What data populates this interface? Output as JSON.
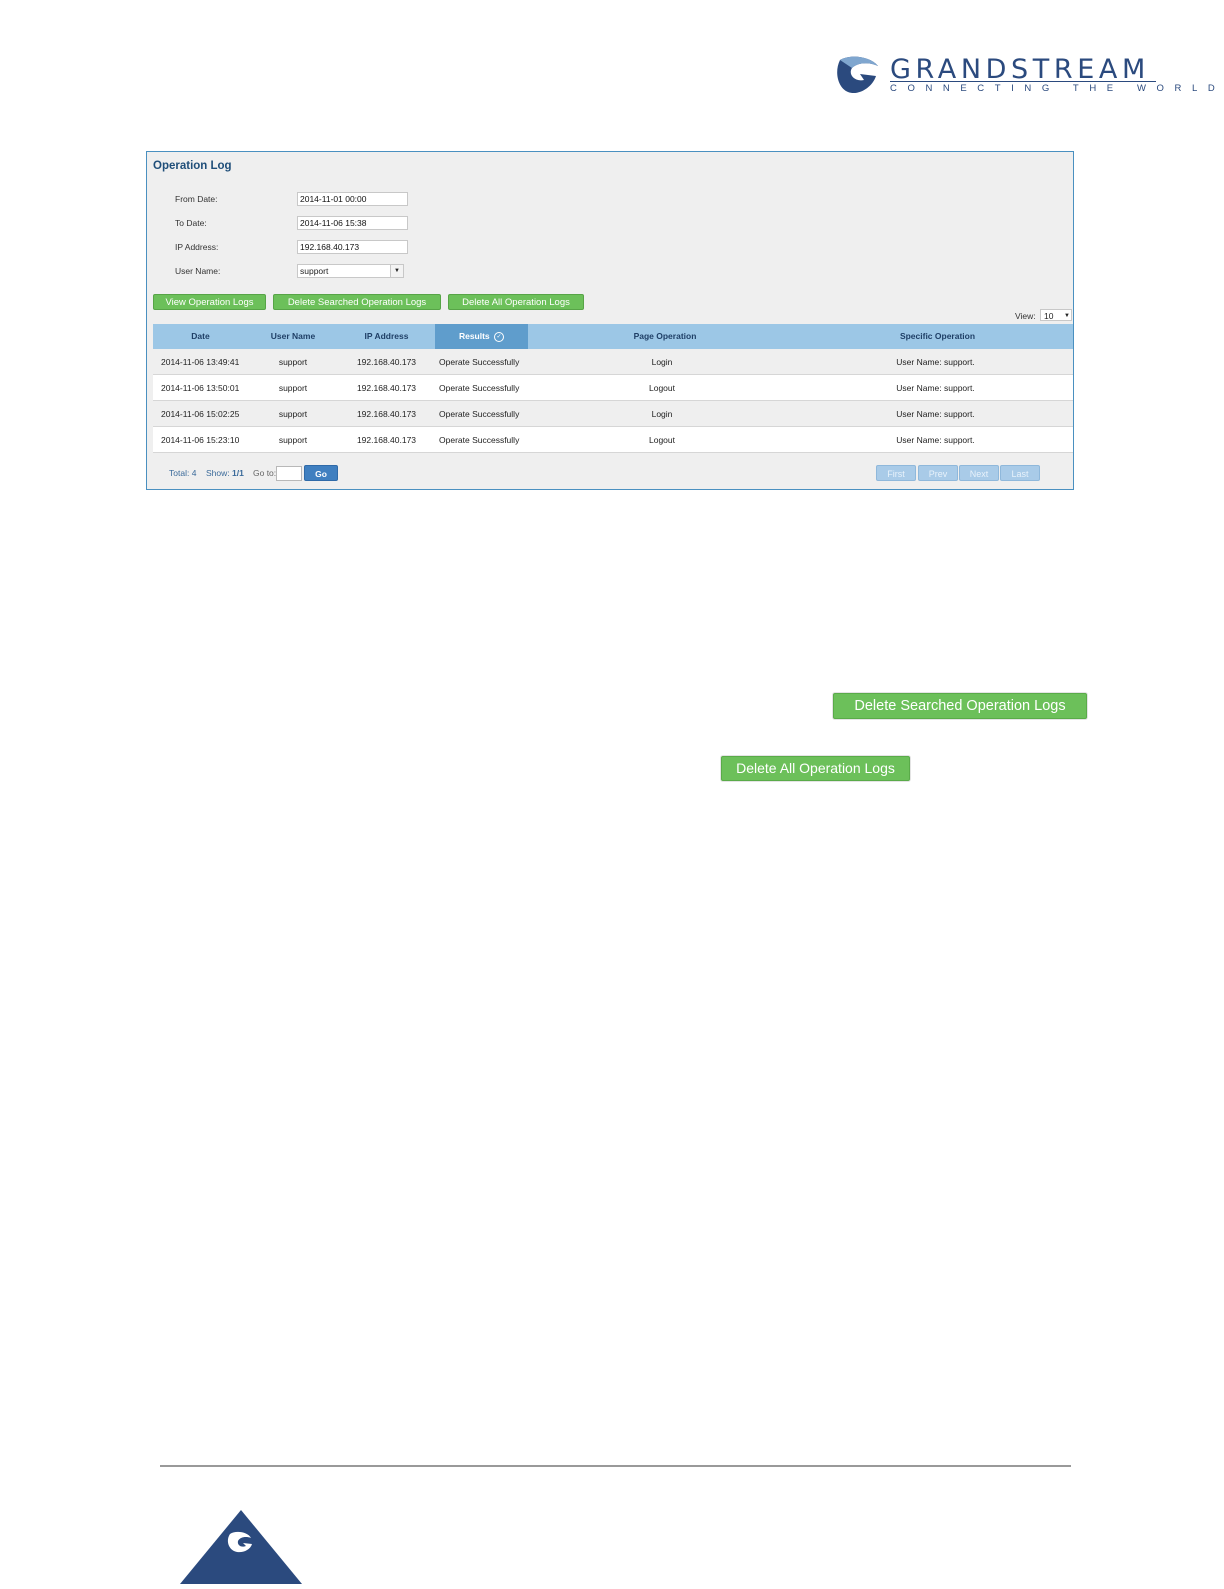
{
  "brand": {
    "name": "GRANDSTREAM",
    "tagline": "CONNECTING THE WORLD",
    "color": "#2b4a7e"
  },
  "panel": {
    "title": "Operation Log",
    "form": {
      "from_date_label": "From Date:",
      "from_date_value": "2014-11-01 00:00",
      "to_date_label": "To Date:",
      "to_date_value": "2014-11-06 15:38",
      "ip_label": "IP Address:",
      "ip_value": "192.168.40.173",
      "user_label": "User Name:",
      "user_value": "support"
    },
    "buttons": {
      "view": "View Operation Logs",
      "delete_searched": "Delete Searched Operation Logs",
      "delete_all": "Delete All Operation Logs"
    },
    "view": {
      "label": "View:",
      "value": "10"
    },
    "columns": [
      "Date",
      "User Name",
      "IP Address",
      "Results",
      "Page Operation",
      "Specific Operation"
    ],
    "rows": [
      [
        "2014-11-06 13:49:41",
        "support",
        "192.168.40.173",
        "Operate Successfully",
        "Login",
        "User Name: support."
      ],
      [
        "2014-11-06 13:50:01",
        "support",
        "192.168.40.173",
        "Operate Successfully",
        "Logout",
        "User Name: support."
      ],
      [
        "2014-11-06 15:02:25",
        "support",
        "192.168.40.173",
        "Operate Successfully",
        "Login",
        "User Name: support."
      ],
      [
        "2014-11-06 15:23:10",
        "support",
        "192.168.40.173",
        "Operate Successfully",
        "Logout",
        "User Name: support."
      ]
    ],
    "footer": {
      "total_label": "Total:",
      "total_value": "4",
      "show_label": "Show:",
      "show_value": "1/1",
      "goto_label": "Go to:",
      "go": "Go",
      "first": "First",
      "prev": "Prev",
      "next": "Next",
      "last": "Last"
    }
  },
  "standalone_buttons": {
    "delete_searched": "Delete Searched Operation Logs",
    "delete_all": "Delete All Operation Logs"
  },
  "colors": {
    "button_green": "#6cc05a",
    "header_blue": "#9cc7e6",
    "active_header": "#5f9dcc",
    "title_blue": "#1f4e79"
  }
}
